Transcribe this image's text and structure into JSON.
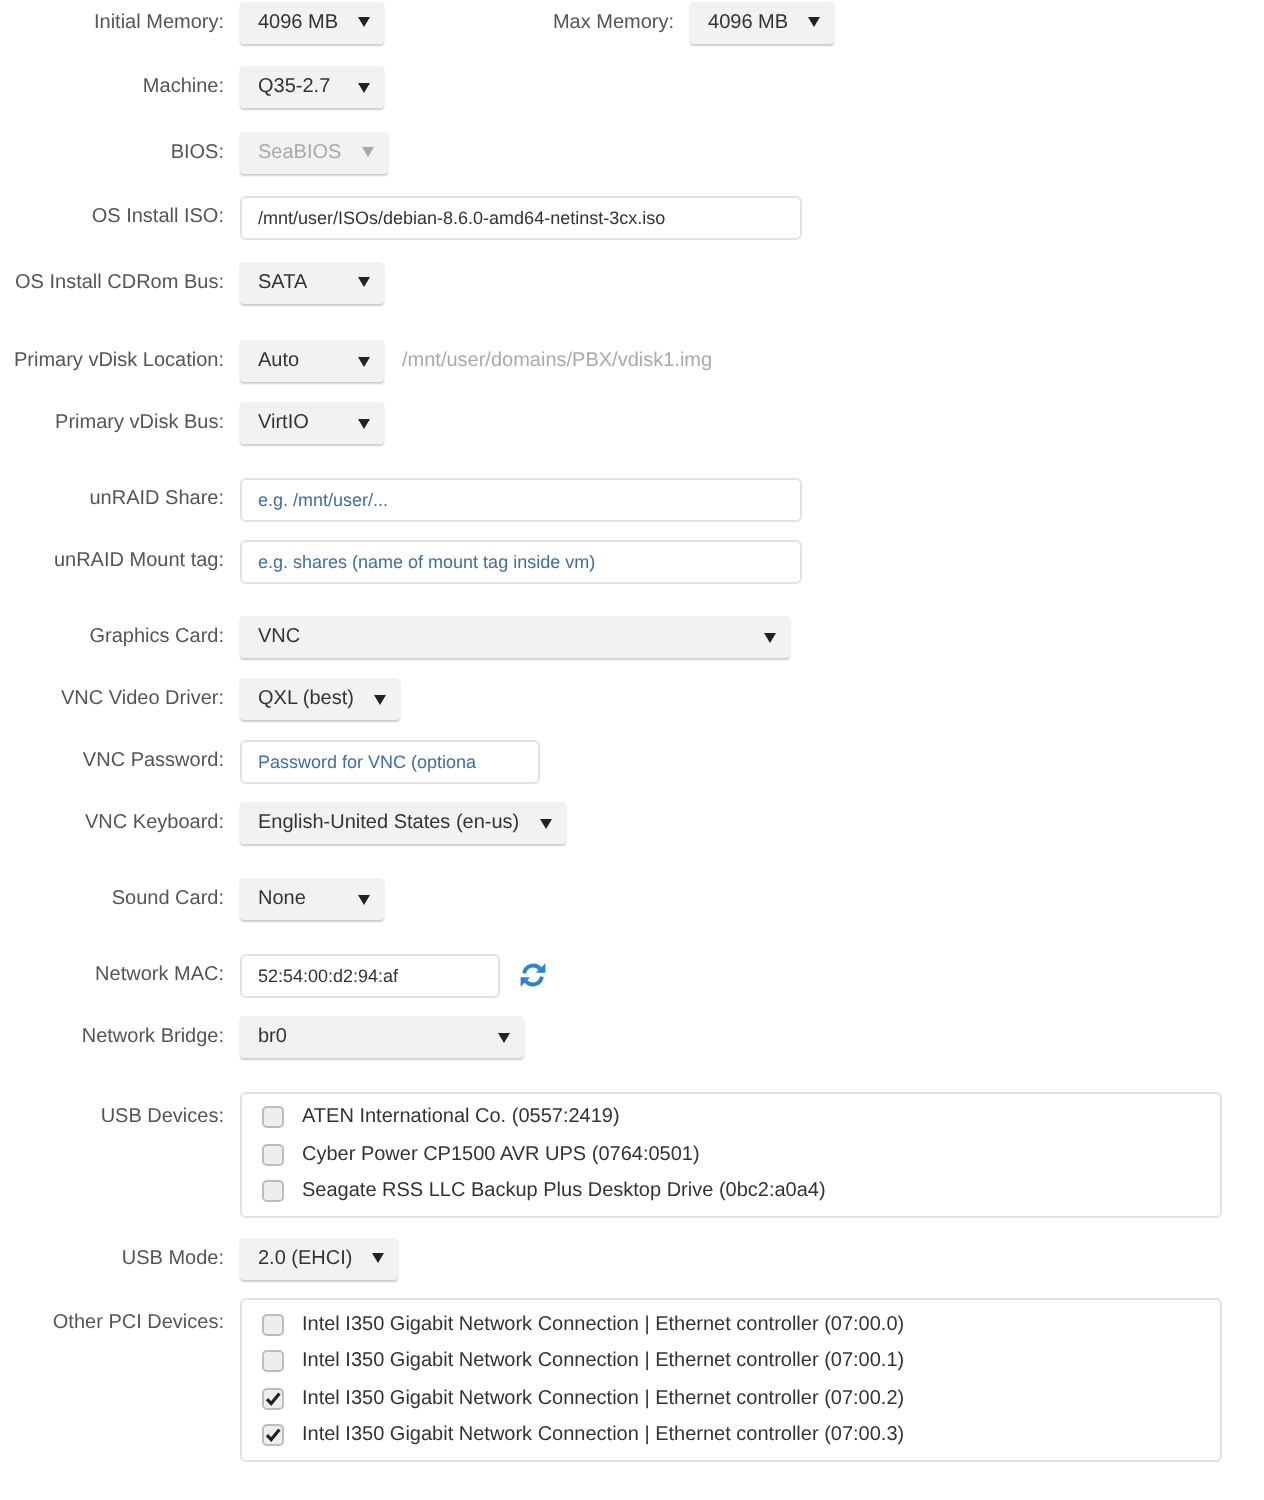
{
  "sections": [
    {
      "rows": [
        {
          "kind": "select",
          "label": "Initial Memory:",
          "value": "4096 MB",
          "disabled": false,
          "paired": {
            "label": "Max Memory:",
            "value": "4096 MB",
            "disabled": false
          }
        },
        {
          "kind": "select",
          "label": "Machine:",
          "value": "Q35-2.7",
          "disabled": false
        },
        {
          "kind": "select",
          "label": "BIOS:",
          "value": "SeaBIOS",
          "disabled": true
        },
        {
          "kind": "input",
          "label": "OS Install ISO:",
          "value": "/mnt/user/ISOs/debian-8.6.0-amd64-netinst-3cx.iso",
          "disabled": false
        },
        {
          "kind": "select",
          "label": "OS Install CDRom Bus:",
          "value": "SATA",
          "disabled": false
        }
      ]
    },
    {
      "rows": [
        {
          "kind": "select",
          "label": "Primary vDisk Location:",
          "value": "Auto",
          "disabled": false,
          "note": "/mnt/user/domains/PBX/vdisk1.img"
        },
        {
          "kind": "select",
          "label": "Primary vDisk Bus:",
          "value": "VirtIO",
          "disabled": false
        }
      ]
    },
    {
      "rows": [
        {
          "kind": "input",
          "label": "unRAID Share:",
          "placeholder": "e.g. /mnt/user/...",
          "disabled": false
        },
        {
          "kind": "input",
          "label": "unRAID Mount tag:",
          "placeholder": "e.g. shares (name of mount tag inside vm)",
          "disabled": false
        }
      ]
    },
    {
      "rows": [
        {
          "kind": "select",
          "label": "Graphics Card:",
          "value": "VNC",
          "disabled": false
        },
        {
          "kind": "select",
          "label": "VNC Video Driver:",
          "value": "QXL (best)",
          "disabled": false
        },
        {
          "kind": "input",
          "label": "VNC Password:",
          "placeholder": "Password for VNC (optiona",
          "disabled": false
        },
        {
          "kind": "select",
          "label": "VNC Keyboard:",
          "value": "English-United States (en-us)",
          "disabled": false
        }
      ]
    },
    {
      "rows": [
        {
          "kind": "select",
          "label": "Sound Card:",
          "value": "None",
          "disabled": false
        }
      ]
    },
    {
      "rows": [
        {
          "kind": "input_with_refresh",
          "label": "Network MAC:",
          "value": "52:54:00:d2:94:af",
          "disabled": false
        },
        {
          "kind": "select",
          "label": "Network Bridge:",
          "value": "br0",
          "disabled": false
        }
      ]
    },
    {
      "rows": [
        {
          "kind": "checklist",
          "label": "USB Devices:",
          "items": [
            {
              "label": "ATEN International Co. (0557:2419)",
              "checked": false
            },
            {
              "label": "Cyber Power CP1500 AVR UPS (0764:0501)",
              "checked": false
            },
            {
              "label": "Seagate RSS LLC Backup Plus Desktop Drive (0bc2:a0a4)",
              "checked": false
            }
          ]
        },
        {
          "kind": "select",
          "label": "USB Mode:",
          "value": "2.0 (EHCI)",
          "disabled": false
        },
        {
          "kind": "checklist",
          "label": "Other PCI Devices:",
          "items": [
            {
              "label": "Intel I350 Gigabit Network Connection | Ethernet controller (07:00.0)",
              "checked": false
            },
            {
              "label": "Intel I350 Gigabit Network Connection | Ethernet controller (07:00.1)",
              "checked": false
            },
            {
              "label": "Intel I350 Gigabit Network Connection | Ethernet controller (07:00.2)",
              "checked": true
            },
            {
              "label": "Intel I350 Gigabit Network Connection | Ethernet controller (07:00.3)",
              "checked": true
            }
          ]
        }
      ]
    }
  ]
}
